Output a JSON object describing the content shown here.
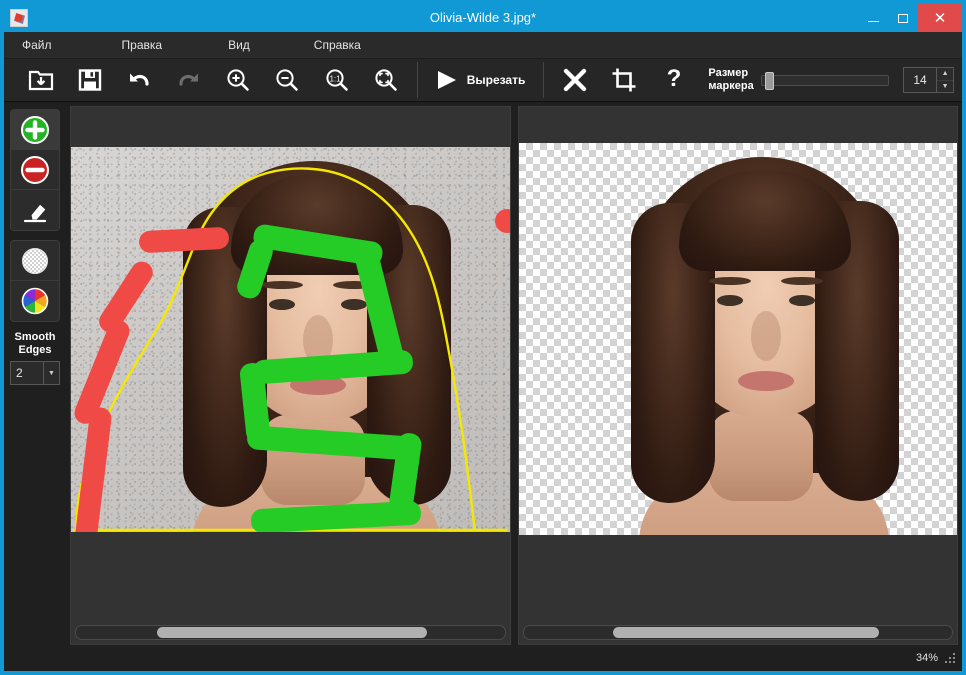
{
  "window": {
    "title": "Olivia-Wilde 3.jpg*",
    "app_icon": "app-icon",
    "minimize_label": "–",
    "maximize_label": "□",
    "close_label": "✕",
    "accent_color": "#1099d4",
    "close_color": "#e04a4a"
  },
  "menu": {
    "items": [
      {
        "label": "Файл",
        "name": "menu-file"
      },
      {
        "label": "Правка",
        "name": "menu-edit"
      },
      {
        "label": "Вид",
        "name": "menu-view"
      },
      {
        "label": "Справка",
        "name": "menu-help"
      }
    ]
  },
  "toolbar": {
    "open_icon": "folder-open-icon",
    "save_icon": "save-icon",
    "undo_icon": "undo-icon",
    "redo_icon": "redo-icon",
    "zoom_in_icon": "zoom-in-icon",
    "zoom_out_icon": "zoom-out-icon",
    "zoom_actual_icon": "zoom-actual-size-icon",
    "zoom_fit_icon": "zoom-fit-icon",
    "cut_label": "Вырезать",
    "cut_icon": "play-icon",
    "delete_icon": "close-x-icon",
    "crop_icon": "crop-icon",
    "help_icon": "question-mark-icon",
    "marker_size_label_line1": "Размер",
    "marker_size_label_line2": "маркера",
    "marker_size_value": "14",
    "marker_slider_percent": 3,
    "spin_up_icon": "▲",
    "spin_down_icon": "▼"
  },
  "sidebar": {
    "tools": [
      {
        "name": "add-to-selection-tool",
        "icon": "green-plus-icon",
        "color": "#22b324",
        "active": true
      },
      {
        "name": "remove-from-selection-tool",
        "icon": "red-minus-icon",
        "color": "#cc2222",
        "active": false
      },
      {
        "name": "eraser-tool",
        "icon": "eraser-icon",
        "color": "#ffffff",
        "active": false
      }
    ],
    "bg_tools": [
      {
        "name": "transparent-background-tool",
        "icon": "checkerboard-circle-icon",
        "active": false
      },
      {
        "name": "color-background-tool",
        "icon": "color-wheel-icon",
        "active": false
      }
    ],
    "smooth_edges_label_line1": "Smooth",
    "smooth_edges_label_line2": "Edges",
    "smooth_edges_value": "2",
    "smooth_edges_arrow": "▼"
  },
  "panels": {
    "source": {
      "name": "source-image-panel",
      "scroll_thumb_left_pct": 19,
      "scroll_thumb_width_pct": 63
    },
    "result": {
      "name": "result-image-panel",
      "scroll_thumb_left_pct": 21,
      "scroll_thumb_width_pct": 62
    }
  },
  "status": {
    "zoom_level": "34%",
    "resize_grip": "resize-grip-icon"
  }
}
